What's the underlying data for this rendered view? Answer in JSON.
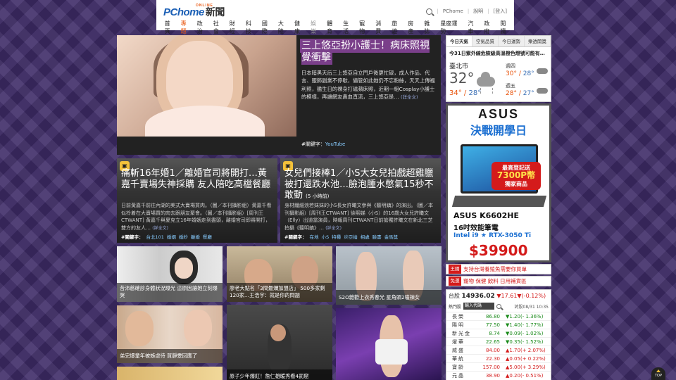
{
  "header": {
    "logo": "PChome",
    "logo_small": "ONLINE",
    "logo_news": "新聞",
    "toplinks": [
      "PChome",
      "說明",
      "登入"
    ],
    "nav": [
      "首頁",
      "專題",
      "政治",
      "社會",
      "財經",
      "科技",
      "國際",
      "大陸",
      "健康",
      "娛樂",
      "體育",
      "生活",
      "寵物",
      "消費",
      "旅遊",
      "房產",
      "雜誌",
      "星座運勢",
      "汽車",
      "政府",
      "閱讀"
    ]
  },
  "feature": {
    "title": "三上悠亞扮小護士！病床照視覺衝擊",
    "summary": "日本暗黑天后三上悠亞自立門戶後更忙碌，成人作品、代言、服飾副業不停歇，儘管如此她仍不忘粉絲，天天上傳福利照，艦生日的裸身打磁蘋床照，近期一組Cosplay小護士的模樣，再讓網友鼻血直流，三上悠亞是…",
    "more": "(詳全文)",
    "tags_label": "#關鍵字：",
    "tags": "YouTube"
  },
  "card_left": {
    "title": "痛斬16年婚1／離婚官司將開打…黃嘉千賣場失神採購 友人陪吃高檔餐廳",
    "summary": "日前黃嘉千前往內湖的美式大賣場買肉。（圖／本刊攝影組）黃嘉千看似拎着在大賣場買的肉去跟朋友聚會。（圖／本刊攝影組）[周刊王CTWANT] 黃嘉千與夏克立16年婚姻走到盡頭，離婚官司即將開打，雙方的友人…",
    "more": "(詳全文)",
    "tags_label": "#關鍵字：",
    "tags": [
      "台北101",
      "婚姻",
      "婚紗",
      "離婚",
      "餐廳"
    ]
  },
  "card_right": {
    "title": "女兒們接棒1／小S大女兒拍戲超雞臘 被打還跌水池…臉泡腫水憋氣15秒不敢動",
    "time": "(5 小時前)",
    "summary": "身材纖細浪若妹妹的小S長女許曦文參與《聽明鎮》的演出。（圖／本刊攝影組）[周刊王CTWANT] 徐熙娣（小S）的16歲大女兒許曦文（Elly）出道當演員，時報周刊CTWANT日前搶獨許曦文在新北三芝拍攝《聽明鎮》…",
    "more": "(詳全文)",
    "tags_label": "#關鍵字：",
    "tags": [
      "在地",
      "小S",
      "特種",
      "炎亞綸",
      "相處",
      "臉書",
      "金馬獎"
    ]
  },
  "thumbs": [
    {
      "caption": "昔沛慈確診身體狀況曝光 這原因讓她立刻爆哭"
    },
    {
      "caption": "廖老大點名「3間最爛加盟店」 500多家剩120家…王浩宇：就是你的問題"
    },
    {
      "caption": "S2O雜歡上衣秀春光 星角頭2嗑辣女"
    },
    {
      "caption": "弟完爆童年被姊虐待 買靜雯回應了"
    },
    {
      "caption": "原子少年爆紅！詹仁雄暖秀看4罰窟"
    },
    {
      "caption": ""
    }
  ],
  "weather": {
    "tabs": [
      "今日天氣",
      "空氣品質",
      "今日運勢",
      "樂透開獎"
    ],
    "headline": "今31日紫外線危險級高溫橙色燈號可能有…",
    "city": "臺北市",
    "temp": "32°",
    "hi": "34°",
    "lo": "28°",
    "r1_label": "週四",
    "r1_hi": "30°",
    "r1_lo": "28°",
    "r2_label": "週五",
    "r2_hi": "28°",
    "r2_lo": "27°"
  },
  "ad": {
    "brand": "ASUS",
    "headline": "決戰開學日",
    "badge_line1": "最高登記送",
    "badge_amount": "7300P幣",
    "badge_line2": "獨家商品",
    "model": "ASUS K6602HE",
    "spec": "16吋效能筆電",
    "cpu": "Intel i9 ★ RTX-3050 Ti",
    "price": "$39900"
  },
  "promos": [
    {
      "label": "王國",
      "text": "支持台灣養殖魚需要你買單"
    },
    {
      "label": "免運",
      "text": "寵物 保健 飲料 日用補貨區"
    }
  ],
  "stock": {
    "label": "台股",
    "index": "14936.02",
    "change": "▼17.61▼(-0.12%)",
    "hot_label": "熱門股",
    "input_placeholder": "輸入代碼",
    "time": "誇股08/31 10:35",
    "rows": [
      {
        "name": "長榮",
        "price": "86.80",
        "change": "▼1.20(- 1.36%)",
        "dir": "dn"
      },
      {
        "name": "陽明",
        "price": "77.50",
        "change": "▼1.40(- 1.77%)",
        "dir": "dn"
      },
      {
        "name": "新光金",
        "price": "8.74",
        "change": "▼0.09(- 1.02%)",
        "dir": "dn"
      },
      {
        "name": "燿華",
        "price": "22.65",
        "change": "▼0.35(- 1.52%)",
        "dir": "dn"
      },
      {
        "name": "威盛",
        "price": "84.00",
        "change": "▲1.70(+ 2.07%)",
        "dir": "up"
      },
      {
        "name": "華航",
        "price": "22.30",
        "change": "▲0.05(+ 0.22%)",
        "dir": "up"
      },
      {
        "name": "寶齡",
        "price": "157.00",
        "change": "▲5.00(+ 3.29%)",
        "dir": "up"
      },
      {
        "name": "元晶",
        "price": "38.90",
        "change": "▲0.20(- 0.51%)",
        "dir": "up"
      }
    ]
  },
  "top_button": "TOP",
  "colors": {
    "accent": "#e8540c",
    "brand": "#1b5fb5",
    "up": "#d41b1b",
    "down": "#1a8a1a",
    "bg": "#3d2a66"
  }
}
